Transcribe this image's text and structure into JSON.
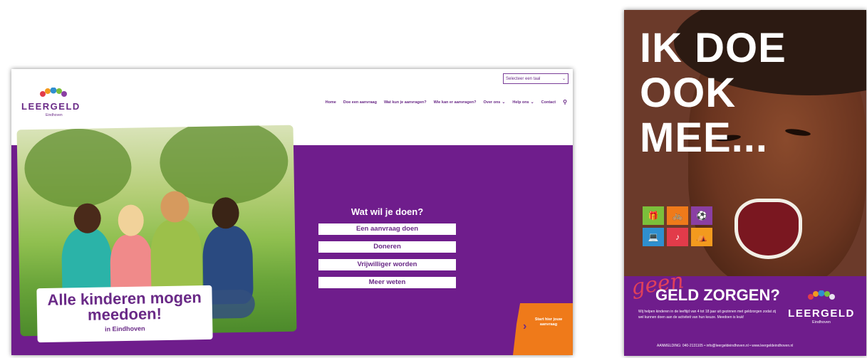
{
  "website": {
    "language_select": {
      "value": "Selecteer een taal"
    },
    "logo": {
      "word": "LEERGELD",
      "city": "Eindhoven"
    },
    "nav": {
      "items": [
        {
          "label": "Home",
          "dropdown": false
        },
        {
          "label": "Doe een aanvraag",
          "dropdown": false
        },
        {
          "label": "Wat kun je aanvragen?",
          "dropdown": false
        },
        {
          "label": "Wie kan er aanvragen?",
          "dropdown": false
        },
        {
          "label": "Over ons",
          "dropdown": true
        },
        {
          "label": "Help ons",
          "dropdown": true
        },
        {
          "label": "Contact",
          "dropdown": false
        }
      ],
      "search_icon": "search-icon"
    },
    "hero": {
      "title": "Alle kinderen mogen meedoen!",
      "subtitle": "in Eindhoven"
    },
    "choice": {
      "heading": "Wat wil je doen?",
      "buttons": [
        "Een aanvraag doen",
        "Doneren",
        "Vrijwilliger worden",
        "Meer weten"
      ]
    },
    "cta": {
      "label": "Start hier jouw aanvraag"
    },
    "colors": {
      "brand_purple": "#6f1d8c",
      "cta_orange": "#ef7a1a"
    }
  },
  "poster": {
    "headline": [
      "IK DOE",
      "OOK",
      "MEE..."
    ],
    "icons": [
      "gift-icon",
      "bicycle-icon",
      "ball-icon",
      "computer-icon",
      "music-icon",
      "camping-icon"
    ],
    "geen": "geen",
    "slogan": "GELD ZORGEN?",
    "description": "Wij helpen kinderen in de leeftijd van 4 tot 18 jaar uit gezinnen met geldzorgen zodat zij wel kunnen doen aan de activiteit van hun keuze. Meedoen is leuk!",
    "logo": {
      "word": "LEERGELD",
      "city": "Eindhoven"
    },
    "footer": "AANMELDING: 040-2131105 • info@leergeldeindhoven.nl • www.leergeldeindhoven.nl"
  }
}
